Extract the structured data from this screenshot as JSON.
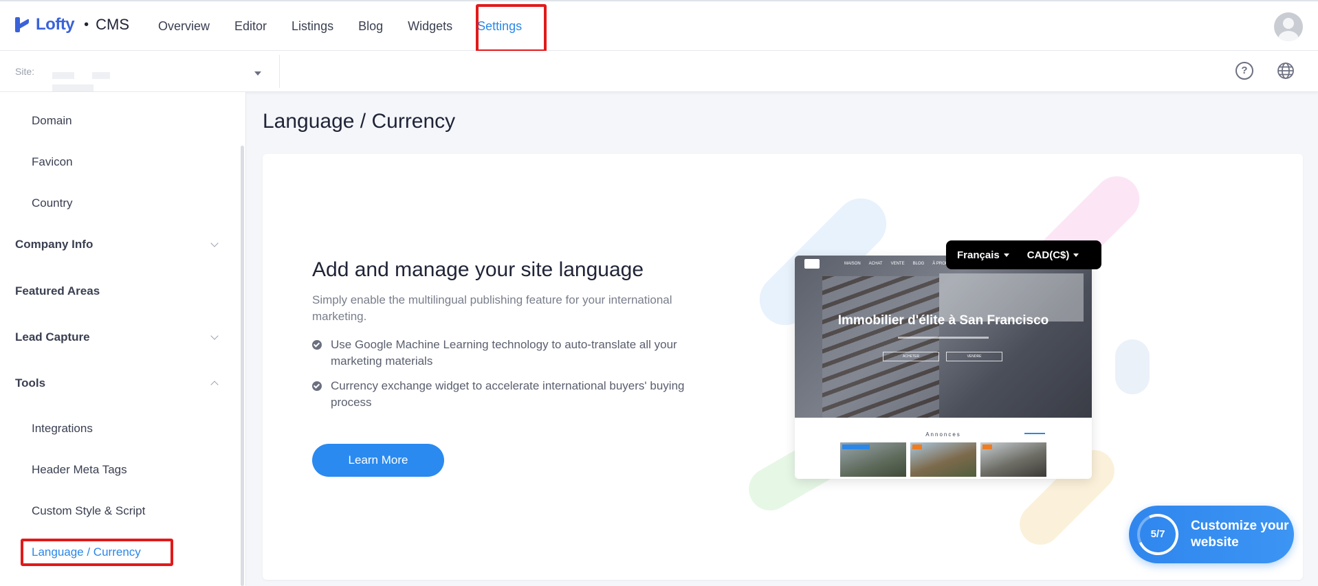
{
  "header": {
    "brand": "Lofty",
    "separator": "•",
    "product": "CMS",
    "nav": [
      {
        "label": "Overview"
      },
      {
        "label": "Editor"
      },
      {
        "label": "Listings"
      },
      {
        "label": "Blog"
      },
      {
        "label": "Widgets"
      },
      {
        "label": "Settings",
        "active": true
      }
    ]
  },
  "subbar": {
    "site_label": "Site:",
    "help_icon": "help-circle-icon",
    "language_icon": "globe-icon"
  },
  "sidebar": {
    "items": [
      {
        "label": "Domain"
      },
      {
        "label": "Favicon"
      },
      {
        "label": "Country"
      }
    ],
    "groups": [
      {
        "label": "Company Info",
        "state": "collapsed"
      },
      {
        "label": "Featured Areas"
      },
      {
        "label": "Lead Capture",
        "state": "collapsed"
      },
      {
        "label": "Tools",
        "state": "expanded"
      }
    ],
    "tools_items": [
      {
        "label": "Integrations"
      },
      {
        "label": "Header Meta Tags"
      },
      {
        "label": "Custom Style & Script"
      },
      {
        "label": "Language / Currency",
        "active": true
      }
    ]
  },
  "main": {
    "title": "Language / Currency",
    "card": {
      "heading": "Add and manage your site language",
      "description": "Simply enable the multilingual publishing feature for your international marketing.",
      "bullets": [
        "Use Google Machine Learning technology to auto-translate all your marketing materials",
        "Currency exchange widget to accelerate international buyers' buying process"
      ],
      "cta": "Learn More"
    },
    "illustration": {
      "language": "Français",
      "currency": "CAD(C$)",
      "hero_title": "Immobilier d'élite à San Francisco",
      "nav_items": [
        "MAISON",
        "ACHAT",
        "VENTE",
        "BLOG",
        "À PROPOS DE"
      ],
      "hero_buttons": [
        "ACHETER",
        "VENDRE"
      ],
      "section_title": "Annonces"
    }
  },
  "widget": {
    "progress": "5/7",
    "label": "Customize your website"
  },
  "colors": {
    "accent": "#2a87e8",
    "brand": "#3a62d9",
    "highlight": "#e11a1a"
  }
}
